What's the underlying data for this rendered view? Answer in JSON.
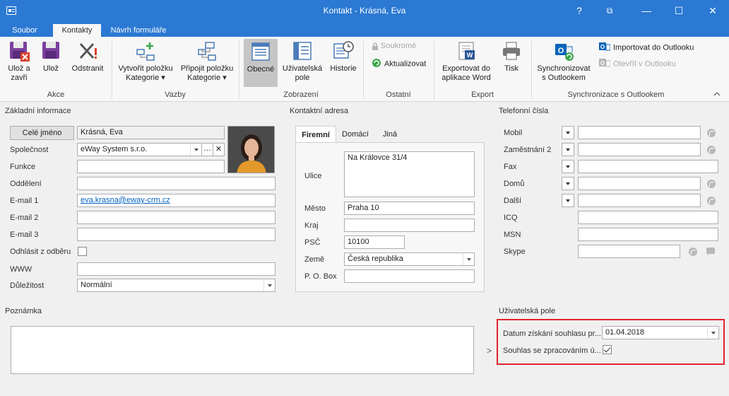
{
  "window": {
    "title": "Kontakt - Krásná,  Eva",
    "controls": [
      "?",
      "⧉",
      "—",
      "☐",
      "✕"
    ]
  },
  "tabs": [
    {
      "label": "Soubor",
      "active": false
    },
    {
      "label": "Kontakty",
      "active": true
    },
    {
      "label": "Návrh formuláře",
      "active": false
    }
  ],
  "ribbon": {
    "groups": {
      "akce": {
        "label": "Akce",
        "buttons": [
          {
            "line1": "Ulož a",
            "line2": "zavři"
          },
          {
            "line1": "Ulož",
            "line2": ""
          },
          {
            "line1": "Odstranit",
            "line2": ""
          }
        ]
      },
      "vazby": {
        "label": "Vazby",
        "buttons": [
          {
            "line1": "Vytvořit položku",
            "line2": "Kategorie ▾"
          },
          {
            "line1": "Připojit položku",
            "line2": "Kategorie ▾"
          }
        ]
      },
      "zobrazeni": {
        "label": "Zobrazení",
        "buttons": [
          {
            "line1": "Obecné",
            "line2": ""
          },
          {
            "line1": "Uživatelská",
            "line2": "pole"
          },
          {
            "line1": "Historie",
            "line2": ""
          }
        ]
      },
      "ostatni": {
        "label": "Ostatní",
        "buttons": [
          {
            "label": "Soukromé",
            "disabled": true
          },
          {
            "label": "Aktualizovat",
            "disabled": false
          }
        ]
      },
      "export": {
        "label": "Export",
        "buttons": [
          {
            "line1": "Exportovat do",
            "line2": "aplikace Word"
          },
          {
            "line1": "Tisk",
            "line2": ""
          }
        ]
      },
      "sync": {
        "label": "Synchronizace s Outlookem",
        "big": {
          "line1": "Synchronizovat",
          "line2": "s Outlookem"
        },
        "small": [
          {
            "label": "Importovat do Outlooku",
            "disabled": false
          },
          {
            "label": "Otevřít v Outlooku",
            "disabled": true
          }
        ]
      }
    }
  },
  "basic": {
    "title": "Základní informace",
    "full_name_button": "Celé jméno",
    "full_name": "Krásná,  Eva",
    "fields": [
      {
        "label": "Společnost",
        "value": "eWay System s.r.o."
      },
      {
        "label": "Funkce",
        "value": ""
      },
      {
        "label": "Oddělení",
        "value": ""
      },
      {
        "label": "E-mail 1",
        "value": "eva.krasna@eway-crm.cz"
      },
      {
        "label": "E-mail 2",
        "value": ""
      },
      {
        "label": "E-mail 3",
        "value": ""
      },
      {
        "label": "Odhlásit z odběru",
        "value": ""
      },
      {
        "label": "WWW",
        "value": ""
      },
      {
        "label": "Důležitost",
        "value": "Normální"
      }
    ]
  },
  "address": {
    "title": "Kontaktní adresa",
    "tabs": [
      "Firemní",
      "Domácí",
      "Jiná"
    ],
    "fields": [
      {
        "label": "Ulice",
        "value": "Na Královce 31/4"
      },
      {
        "label": "Město",
        "value": "Praha 10"
      },
      {
        "label": "Kraj",
        "value": ""
      },
      {
        "label": "PSČ",
        "value": "10100"
      },
      {
        "label": "Země",
        "value": "Česká republika"
      },
      {
        "label": "P. O. Box",
        "value": ""
      }
    ]
  },
  "phones": {
    "title": "Telefonní čísla",
    "fields": [
      {
        "label": "Mobil",
        "value": ""
      },
      {
        "label": "Zaměstnání 2",
        "value": ""
      },
      {
        "label": "Fax",
        "value": ""
      },
      {
        "label": "Domů",
        "value": ""
      },
      {
        "label": "Další",
        "value": ""
      },
      {
        "label": "ICQ",
        "value": ""
      },
      {
        "label": "MSN",
        "value": ""
      },
      {
        "label": "Skype",
        "value": ""
      }
    ]
  },
  "note": {
    "title": "Poznámka",
    "value": ""
  },
  "user_fields": {
    "title": "Uživatelská pole",
    "expander": ">",
    "fields": [
      {
        "label": "Datum získání souhlasu pr...",
        "value": "01.04.2018"
      },
      {
        "label": "Souhlas se zpracováním ú...",
        "checked": true
      }
    ]
  },
  "colors": {
    "titlebar": "#2b79d3",
    "highlight_border": "#e0252f",
    "link": "#0563c1"
  }
}
